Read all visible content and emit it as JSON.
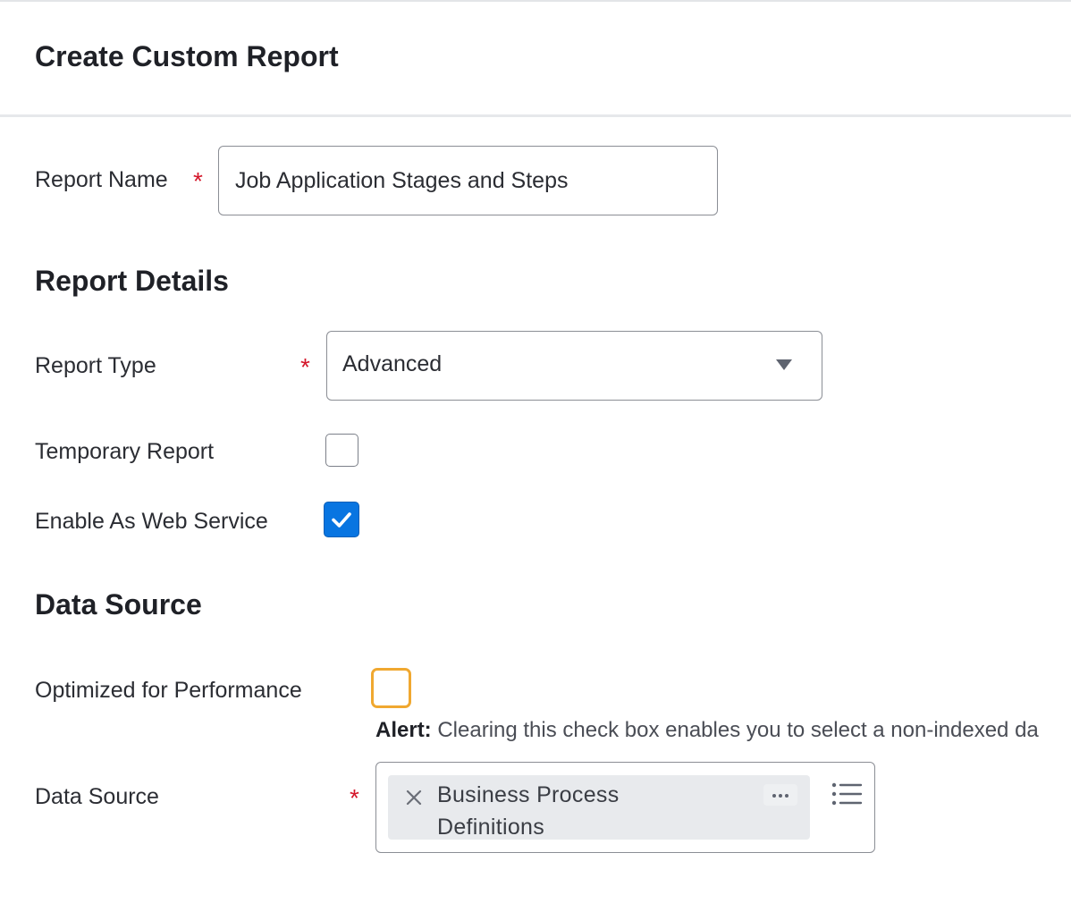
{
  "header": {
    "title": "Create Custom Report"
  },
  "report_name": {
    "label": "Report Name",
    "required_mark": "*",
    "value": "Job Application Stages and Steps"
  },
  "report_details": {
    "title": "Report Details",
    "report_type": {
      "label": "Report Type",
      "required_mark": "*",
      "value": "Advanced",
      "icon": "chevron-down-icon"
    },
    "temporary_report": {
      "label": "Temporary Report",
      "checked": false
    },
    "enable_web_service": {
      "label": "Enable As Web Service",
      "checked": true
    }
  },
  "data_source_section": {
    "title": "Data Source",
    "optimized": {
      "label": "Optimized for Performance",
      "checked": false
    },
    "alert": {
      "prefix": "Alert:",
      "text": " Clearing this check box enables you to select a non-indexed da"
    },
    "data_source": {
      "label": "Data Source",
      "required_mark": "*",
      "selected_item": "Business Process Definitions",
      "more_label": "···"
    }
  },
  "colors": {
    "required": "#d4162a",
    "checkbox_checked": "#0875e1",
    "focus_outline": "#f0a830",
    "pill_background": "#e8eaed"
  }
}
